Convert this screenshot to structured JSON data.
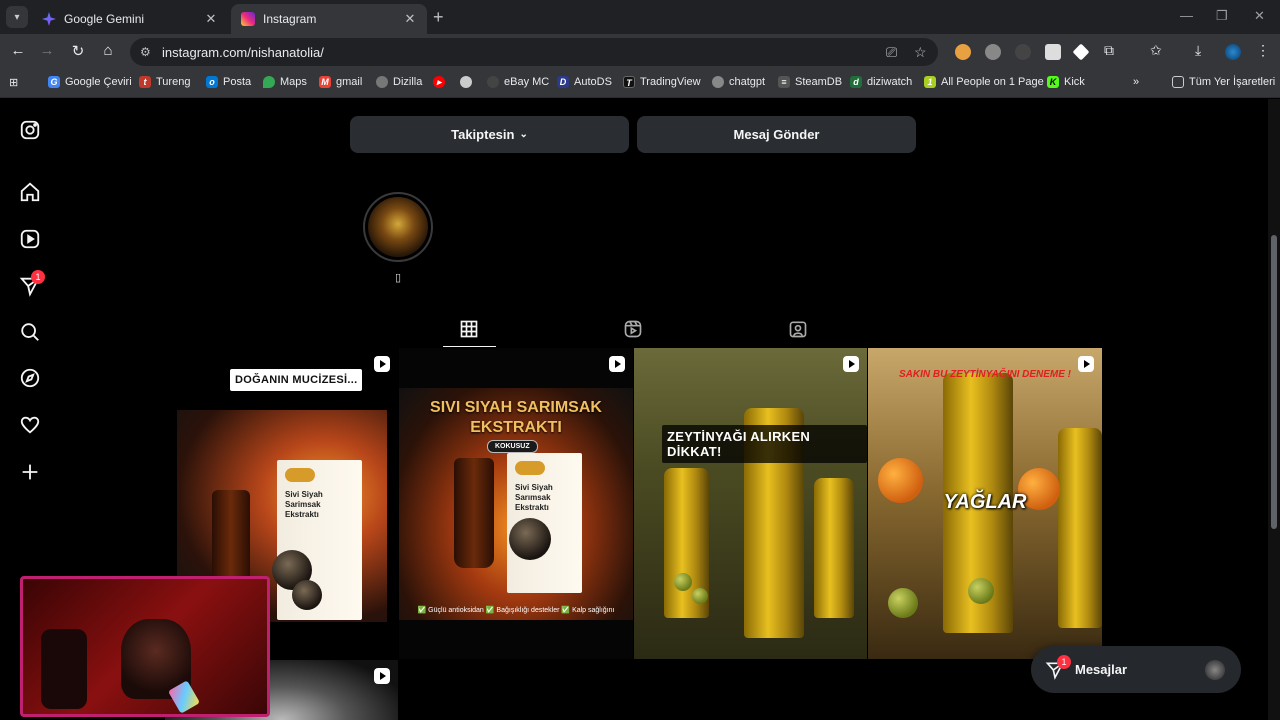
{
  "browser": {
    "tabs": [
      {
        "title": "Google Gemini",
        "active": false,
        "favicon": "gemini-icon",
        "color": "#4285f4"
      },
      {
        "title": "Instagram",
        "active": true,
        "favicon": "instagram-icon",
        "color": "#e1306c"
      }
    ],
    "url": "instagram.com/nishanatolia/",
    "bookmarks": [
      {
        "label": "Google Çeviri",
        "icon": "translate-icon",
        "color": "#4285f4"
      },
      {
        "label": "Tureng",
        "icon": "tureng-icon",
        "color": "#c0392b"
      },
      {
        "label": "Posta",
        "icon": "mail-icon",
        "color": "#0078d4"
      },
      {
        "label": "Maps",
        "icon": "maps-icon",
        "color": "#34a853"
      },
      {
        "label": "gmail",
        "icon": "gmail-icon",
        "color": "#ea4335"
      },
      {
        "label": "Dizilla",
        "icon": "dizilla-icon",
        "color": "#777777"
      },
      {
        "label": "",
        "icon": "youtube-icon",
        "color": "#ff0000"
      },
      {
        "label": "",
        "icon": "openai-icon",
        "color": "#cccccc"
      },
      {
        "label": "eBay MC",
        "icon": "ebay-icon",
        "color": "#444444"
      },
      {
        "label": "AutoDS",
        "icon": "autods-icon",
        "color": "#2b3a8a"
      },
      {
        "label": "TradingView",
        "icon": "tradingview-icon",
        "color": "#111111"
      },
      {
        "label": "chatgpt",
        "icon": "chatgpt-icon",
        "color": "#888888"
      },
      {
        "label": "SteamDB",
        "icon": "steamdb-icon",
        "color": "#555555"
      },
      {
        "label": "diziwatch",
        "icon": "diziwatch-icon",
        "color": "#1f6f3a"
      },
      {
        "label": "All People on 1 Page",
        "icon": "allpeople-icon",
        "color": "#a8d020"
      },
      {
        "label": "Kick",
        "icon": "kick-icon",
        "color": "#53fc18"
      }
    ],
    "all_bookmarks_label": "Tüm Yer İşaretleri"
  },
  "sidebar": {
    "notifications_badge": "1",
    "items": [
      "instagram-logo-icon",
      "home-icon",
      "reels-icon",
      "messages-icon",
      "search-icon",
      "explore-icon",
      "heart-icon",
      "create-icon",
      "menu-icon",
      "more-apps-icon"
    ]
  },
  "profile": {
    "follow_button": "Takiptesin",
    "message_button": "Mesaj Gönder",
    "highlight_label": "▯"
  },
  "posts": [
    {
      "type": "reel",
      "caption": "DOĞANIN MUCİZESİ...",
      "product_label": "Sivi Siyah Sarimsak Ekstraktı"
    },
    {
      "type": "reel",
      "headline": "SIVI SIYAH SARIMSAK EKSTRAKTI",
      "pill": "KOKUSUZ",
      "product_label": "Sivi Siyah Sarımsak Ekstraktı",
      "benefits": "✅ Güçlü antioksidan  ✅ Bağışıklığı destekler  ✅ Kalp sağlığını"
    },
    {
      "type": "reel",
      "caption": "ZEYTİNYAĞI ALIRKEN DİKKAT!"
    },
    {
      "type": "reel",
      "top_text": "SAKIN BU ZEYTİNYAĞINI DENEME !",
      "caption": "YAĞLAR"
    },
    {
      "type": "reel"
    }
  ],
  "messages_bar": {
    "label": "Mesajlar",
    "badge": "1"
  },
  "colors": {
    "accent_badge": "#ff3040",
    "button_bg": "#2a2d31",
    "webcam_border": "#c02070"
  }
}
